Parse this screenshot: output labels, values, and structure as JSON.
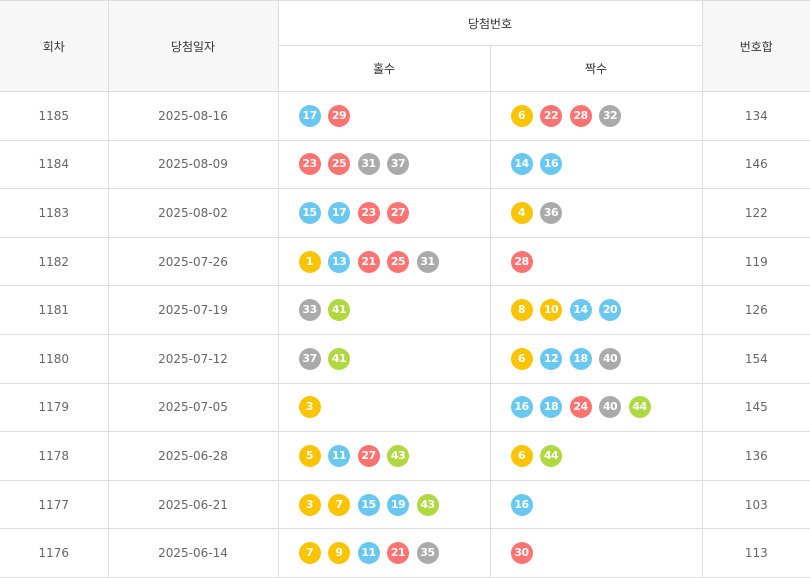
{
  "headers": {
    "round": "회차",
    "date": "당첨일자",
    "winning_numbers": "당첨번호",
    "odd": "홀수",
    "even": "짝수",
    "sum": "번호합"
  },
  "colors": {
    "yellow": "#fbc400",
    "blue": "#69c8f2",
    "red": "#ff7272",
    "gray": "#aaaaaa",
    "green": "#b0d840"
  },
  "rows": [
    {
      "round": "1185",
      "date": "2025-08-16",
      "odd": [
        17,
        29
      ],
      "even": [
        6,
        22,
        28,
        32
      ],
      "sum": "134"
    },
    {
      "round": "1184",
      "date": "2025-08-09",
      "odd": [
        23,
        25,
        31,
        37
      ],
      "even": [
        14,
        16
      ],
      "sum": "146"
    },
    {
      "round": "1183",
      "date": "2025-08-02",
      "odd": [
        15,
        17,
        23,
        27
      ],
      "even": [
        4,
        36
      ],
      "sum": "122"
    },
    {
      "round": "1182",
      "date": "2025-07-26",
      "odd": [
        1,
        13,
        21,
        25,
        31
      ],
      "even": [
        28
      ],
      "sum": "119"
    },
    {
      "round": "1181",
      "date": "2025-07-19",
      "odd": [
        33,
        41
      ],
      "even": [
        8,
        10,
        14,
        20
      ],
      "sum": "126"
    },
    {
      "round": "1180",
      "date": "2025-07-12",
      "odd": [
        37,
        41
      ],
      "even": [
        6,
        12,
        18,
        40
      ],
      "sum": "154"
    },
    {
      "round": "1179",
      "date": "2025-07-05",
      "odd": [
        3
      ],
      "even": [
        16,
        18,
        24,
        40,
        44
      ],
      "sum": "145"
    },
    {
      "round": "1178",
      "date": "2025-06-28",
      "odd": [
        5,
        11,
        27,
        43
      ],
      "even": [
        6,
        44
      ],
      "sum": "136"
    },
    {
      "round": "1177",
      "date": "2025-06-21",
      "odd": [
        3,
        7,
        15,
        19,
        43
      ],
      "even": [
        16
      ],
      "sum": "103"
    },
    {
      "round": "1176",
      "date": "2025-06-14",
      "odd": [
        7,
        9,
        11,
        21,
        35
      ],
      "even": [
        30
      ],
      "sum": "113"
    }
  ]
}
